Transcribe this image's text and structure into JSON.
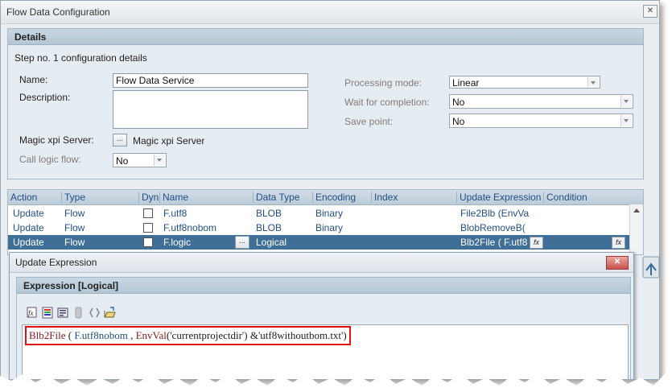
{
  "window": {
    "title": "Flow Data Configuration",
    "close_label": "✕"
  },
  "details": {
    "header": "Details",
    "step_text": "Step no. 1 configuration details",
    "name_label": "Name:",
    "name_value": "Flow Data Service",
    "description_label": "Description:",
    "description_value": "",
    "server_label": "Magic xpi Server:",
    "server_button": "...",
    "server_value": "Magic xpi Server",
    "call_logic_label": "Call logic flow:",
    "call_logic_value": "No",
    "processing_mode_label": "Processing mode:",
    "processing_mode_value": "Linear",
    "wait_label": "Wait for completion:",
    "wait_value": "No",
    "save_point_label": "Save point:",
    "save_point_value": "No"
  },
  "grid": {
    "columns": [
      "Action",
      "Type",
      "Dyn",
      "Name",
      "Data Type",
      "Encoding",
      "Index",
      "Update Expression",
      "Condition"
    ],
    "rows": [
      {
        "action": "Update",
        "type": "Flow",
        "name": "F.utf8",
        "data_type": "BLOB",
        "encoding": "Binary",
        "update_expression": "File2Blb (EnvVa",
        "selected": false
      },
      {
        "action": "Update",
        "type": "Flow",
        "name": "F.utf8nobom",
        "data_type": "BLOB",
        "encoding": "Binary",
        "update_expression": "BlobRemoveB(",
        "selected": false
      },
      {
        "action": "Update",
        "type": "Flow",
        "name": "F.logic",
        "data_type": "Logical",
        "encoding": "",
        "update_expression": "Blb2File ( F.utf8",
        "selected": true
      }
    ],
    "row_button": "...",
    "fx_label": "fx"
  },
  "dialog": {
    "title": "Update Expression",
    "close_label": "✕",
    "section_header": "Expression [Logical]",
    "toolbar_icons": [
      "function-wizard-icon",
      "variables-icon",
      "check-syntax-icon",
      "disabled-icon",
      "brackets-icon",
      "open-icon"
    ],
    "expression": {
      "fn": "Blb2File",
      "open": " ( ",
      "var": "F.utf8nobom",
      "comma": " , ",
      "fn2": "EnvVal",
      "arg": "('currentprojectdir')",
      "amp": " &",
      "str": "'utf8withoutbom.txt'",
      "close": ")"
    }
  }
}
